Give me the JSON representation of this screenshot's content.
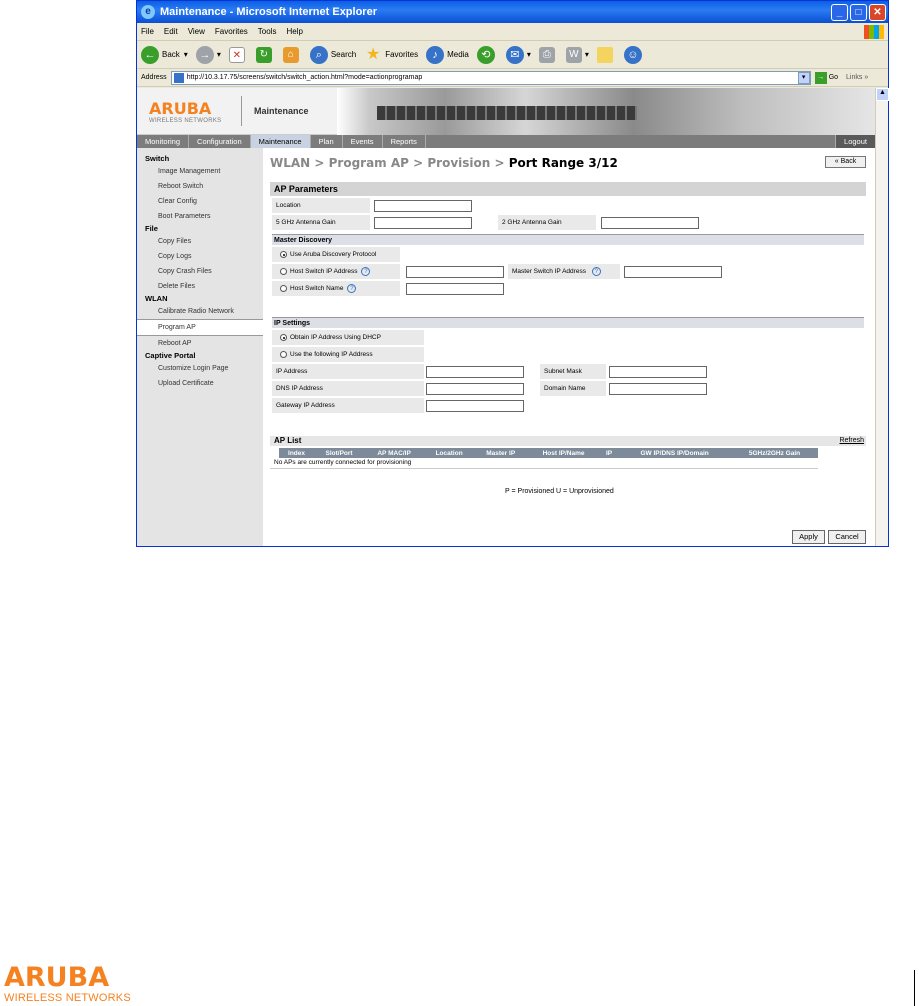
{
  "window": {
    "title": "Maintenance - Microsoft Internet Explorer"
  },
  "menubar": [
    "File",
    "Edit",
    "View",
    "Favorites",
    "Tools",
    "Help"
  ],
  "toolbar": {
    "back": "Back",
    "search": "Search",
    "favorites": "Favorites",
    "media": "Media"
  },
  "addressbar": {
    "label": "Address",
    "url": "http://10.3.17.75/screens/switch/switch_action.html?mode=actionprogramap",
    "go": "Go",
    "links": "Links"
  },
  "header": {
    "brand": "ARUBA",
    "brand_sub": "WIRELESS NETWORKS",
    "section": "Maintenance"
  },
  "nav": {
    "tabs": [
      "Monitoring",
      "Configuration",
      "Maintenance",
      "Plan",
      "Events",
      "Reports"
    ],
    "active": "Maintenance",
    "logout": "Logout"
  },
  "sidebar": {
    "groups": [
      {
        "title": "Switch",
        "items": [
          "Image Management",
          "Reboot Switch",
          "Clear Config",
          "Boot Parameters"
        ]
      },
      {
        "title": "File",
        "items": [
          "Copy Files",
          "Copy Logs",
          "Copy Crash Files",
          "Delete Files"
        ]
      },
      {
        "title": "WLAN",
        "items": [
          "Calibrate Radio Network",
          "Program AP",
          "Reboot AP"
        ]
      },
      {
        "title": "Captive Portal",
        "items": [
          "Customize Login Page",
          "Upload Certificate"
        ]
      }
    ],
    "active": "Program AP"
  },
  "page": {
    "breadcrumb": "WLAN > Program AP > Provision > ",
    "current": "Port Range 3/12",
    "back": "« Back"
  },
  "ap_params": {
    "title": "AP Parameters",
    "location_label": "Location",
    "gain5_label": "5 GHz Antenna Gain",
    "gain2_label": "2 GHz Antenna Gain"
  },
  "master_discovery": {
    "title": "Master Discovery",
    "opt_adp": "Use Aruba Discovery Protocol",
    "opt_host_ip": "Host Switch IP Address",
    "master_ip_label": "Master Switch IP Address",
    "opt_host_name": "Host Switch Name",
    "help": "?"
  },
  "ip_settings": {
    "title": "IP Settings",
    "opt_dhcp": "Obtain IP Address Using DHCP",
    "opt_static": "Use the following IP Address",
    "ip_label": "IP Address",
    "mask_label": "Subnet Mask",
    "dns_label": "DNS IP Address",
    "domain_label": "Domain Name",
    "gateway_label": "Gateway IP Address"
  },
  "ap_list": {
    "title": "AP List",
    "refresh": "Refresh",
    "columns": [
      "Index",
      "Slot/Port",
      "AP MAC/IP",
      "Location",
      "Master IP",
      "Host IP/Name",
      "IP",
      "GW IP/DNS IP/Domain",
      "5GHz/2GHz Gain"
    ],
    "empty": "No APs are currently connected for provisioning",
    "legend": "P = Provisioned U = Unprovisioned"
  },
  "buttons": {
    "apply": "Apply",
    "cancel": "Cancel"
  },
  "footer": {
    "brand": "ARUBA",
    "brand_sub": "WIRELESS NETWORKS"
  }
}
